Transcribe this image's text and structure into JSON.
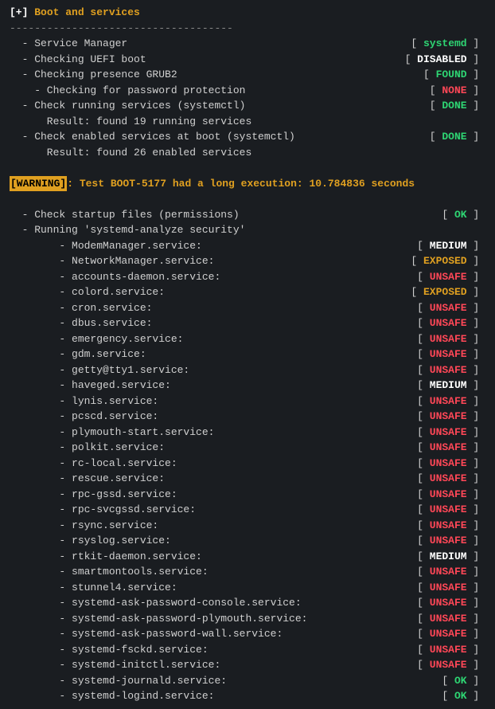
{
  "header": {
    "prefix": "[+]",
    "title": "Boot and services",
    "separator": "------------------------------------"
  },
  "items": [
    {
      "indent": 1,
      "label": "Service Manager",
      "status": "systemd",
      "color": "green"
    },
    {
      "indent": 1,
      "label": "Checking UEFI boot",
      "status": "DISABLED",
      "color": "white"
    },
    {
      "indent": 1,
      "label": "Checking presence GRUB2",
      "status": "FOUND",
      "color": "green"
    },
    {
      "indent": 2,
      "label": "Checking for password protection",
      "status": "NONE",
      "color": "red"
    },
    {
      "indent": 1,
      "label": "Check running services (systemctl)",
      "status": "DONE",
      "color": "green"
    },
    {
      "indent": 0,
      "label": "      Result: found 19 running services"
    },
    {
      "indent": 1,
      "label": "Check enabled services at boot (systemctl)",
      "status": "DONE",
      "color": "green"
    },
    {
      "indent": 0,
      "label": "      Result: found 26 enabled services"
    }
  ],
  "warning": {
    "badge": "[WARNING]",
    "text": ": Test BOOT-5177 had a long execution: 10.784836 seconds"
  },
  "items2": [
    {
      "indent": 1,
      "label": "Check startup files (permissions)",
      "status": "OK",
      "color": "green"
    },
    {
      "indent": 1,
      "label": "Running 'systemd-analyze security'"
    }
  ],
  "services": [
    {
      "name": "ModemManager.service:",
      "status": "MEDIUM",
      "color": "white"
    },
    {
      "name": "NetworkManager.service:",
      "status": "EXPOSED",
      "color": "orange"
    },
    {
      "name": "accounts-daemon.service:",
      "status": "UNSAFE",
      "color": "red"
    },
    {
      "name": "colord.service:",
      "status": "EXPOSED",
      "color": "orange"
    },
    {
      "name": "cron.service:",
      "status": "UNSAFE",
      "color": "red"
    },
    {
      "name": "dbus.service:",
      "status": "UNSAFE",
      "color": "red"
    },
    {
      "name": "emergency.service:",
      "status": "UNSAFE",
      "color": "red"
    },
    {
      "name": "gdm.service:",
      "status": "UNSAFE",
      "color": "red"
    },
    {
      "name": "getty@tty1.service:",
      "status": "UNSAFE",
      "color": "red"
    },
    {
      "name": "haveged.service:",
      "status": "MEDIUM",
      "color": "white"
    },
    {
      "name": "lynis.service:",
      "status": "UNSAFE",
      "color": "red"
    },
    {
      "name": "pcscd.service:",
      "status": "UNSAFE",
      "color": "red"
    },
    {
      "name": "plymouth-start.service:",
      "status": "UNSAFE",
      "color": "red"
    },
    {
      "name": "polkit.service:",
      "status": "UNSAFE",
      "color": "red"
    },
    {
      "name": "rc-local.service:",
      "status": "UNSAFE",
      "color": "red"
    },
    {
      "name": "rescue.service:",
      "status": "UNSAFE",
      "color": "red"
    },
    {
      "name": "rpc-gssd.service:",
      "status": "UNSAFE",
      "color": "red"
    },
    {
      "name": "rpc-svcgssd.service:",
      "status": "UNSAFE",
      "color": "red"
    },
    {
      "name": "rsync.service:",
      "status": "UNSAFE",
      "color": "red"
    },
    {
      "name": "rsyslog.service:",
      "status": "UNSAFE",
      "color": "red"
    },
    {
      "name": "rtkit-daemon.service:",
      "status": "MEDIUM",
      "color": "white"
    },
    {
      "name": "smartmontools.service:",
      "status": "UNSAFE",
      "color": "red"
    },
    {
      "name": "stunnel4.service:",
      "status": "UNSAFE",
      "color": "red"
    },
    {
      "name": "systemd-ask-password-console.service:",
      "status": "UNSAFE",
      "color": "red"
    },
    {
      "name": "systemd-ask-password-plymouth.service:",
      "status": "UNSAFE",
      "color": "red"
    },
    {
      "name": "systemd-ask-password-wall.service:",
      "status": "UNSAFE",
      "color": "red"
    },
    {
      "name": "systemd-fsckd.service:",
      "status": "UNSAFE",
      "color": "red"
    },
    {
      "name": "systemd-initctl.service:",
      "status": "UNSAFE",
      "color": "red"
    },
    {
      "name": "systemd-journald.service:",
      "status": "OK",
      "color": "green"
    },
    {
      "name": "systemd-logind.service:",
      "status": "OK",
      "color": "green"
    }
  ]
}
